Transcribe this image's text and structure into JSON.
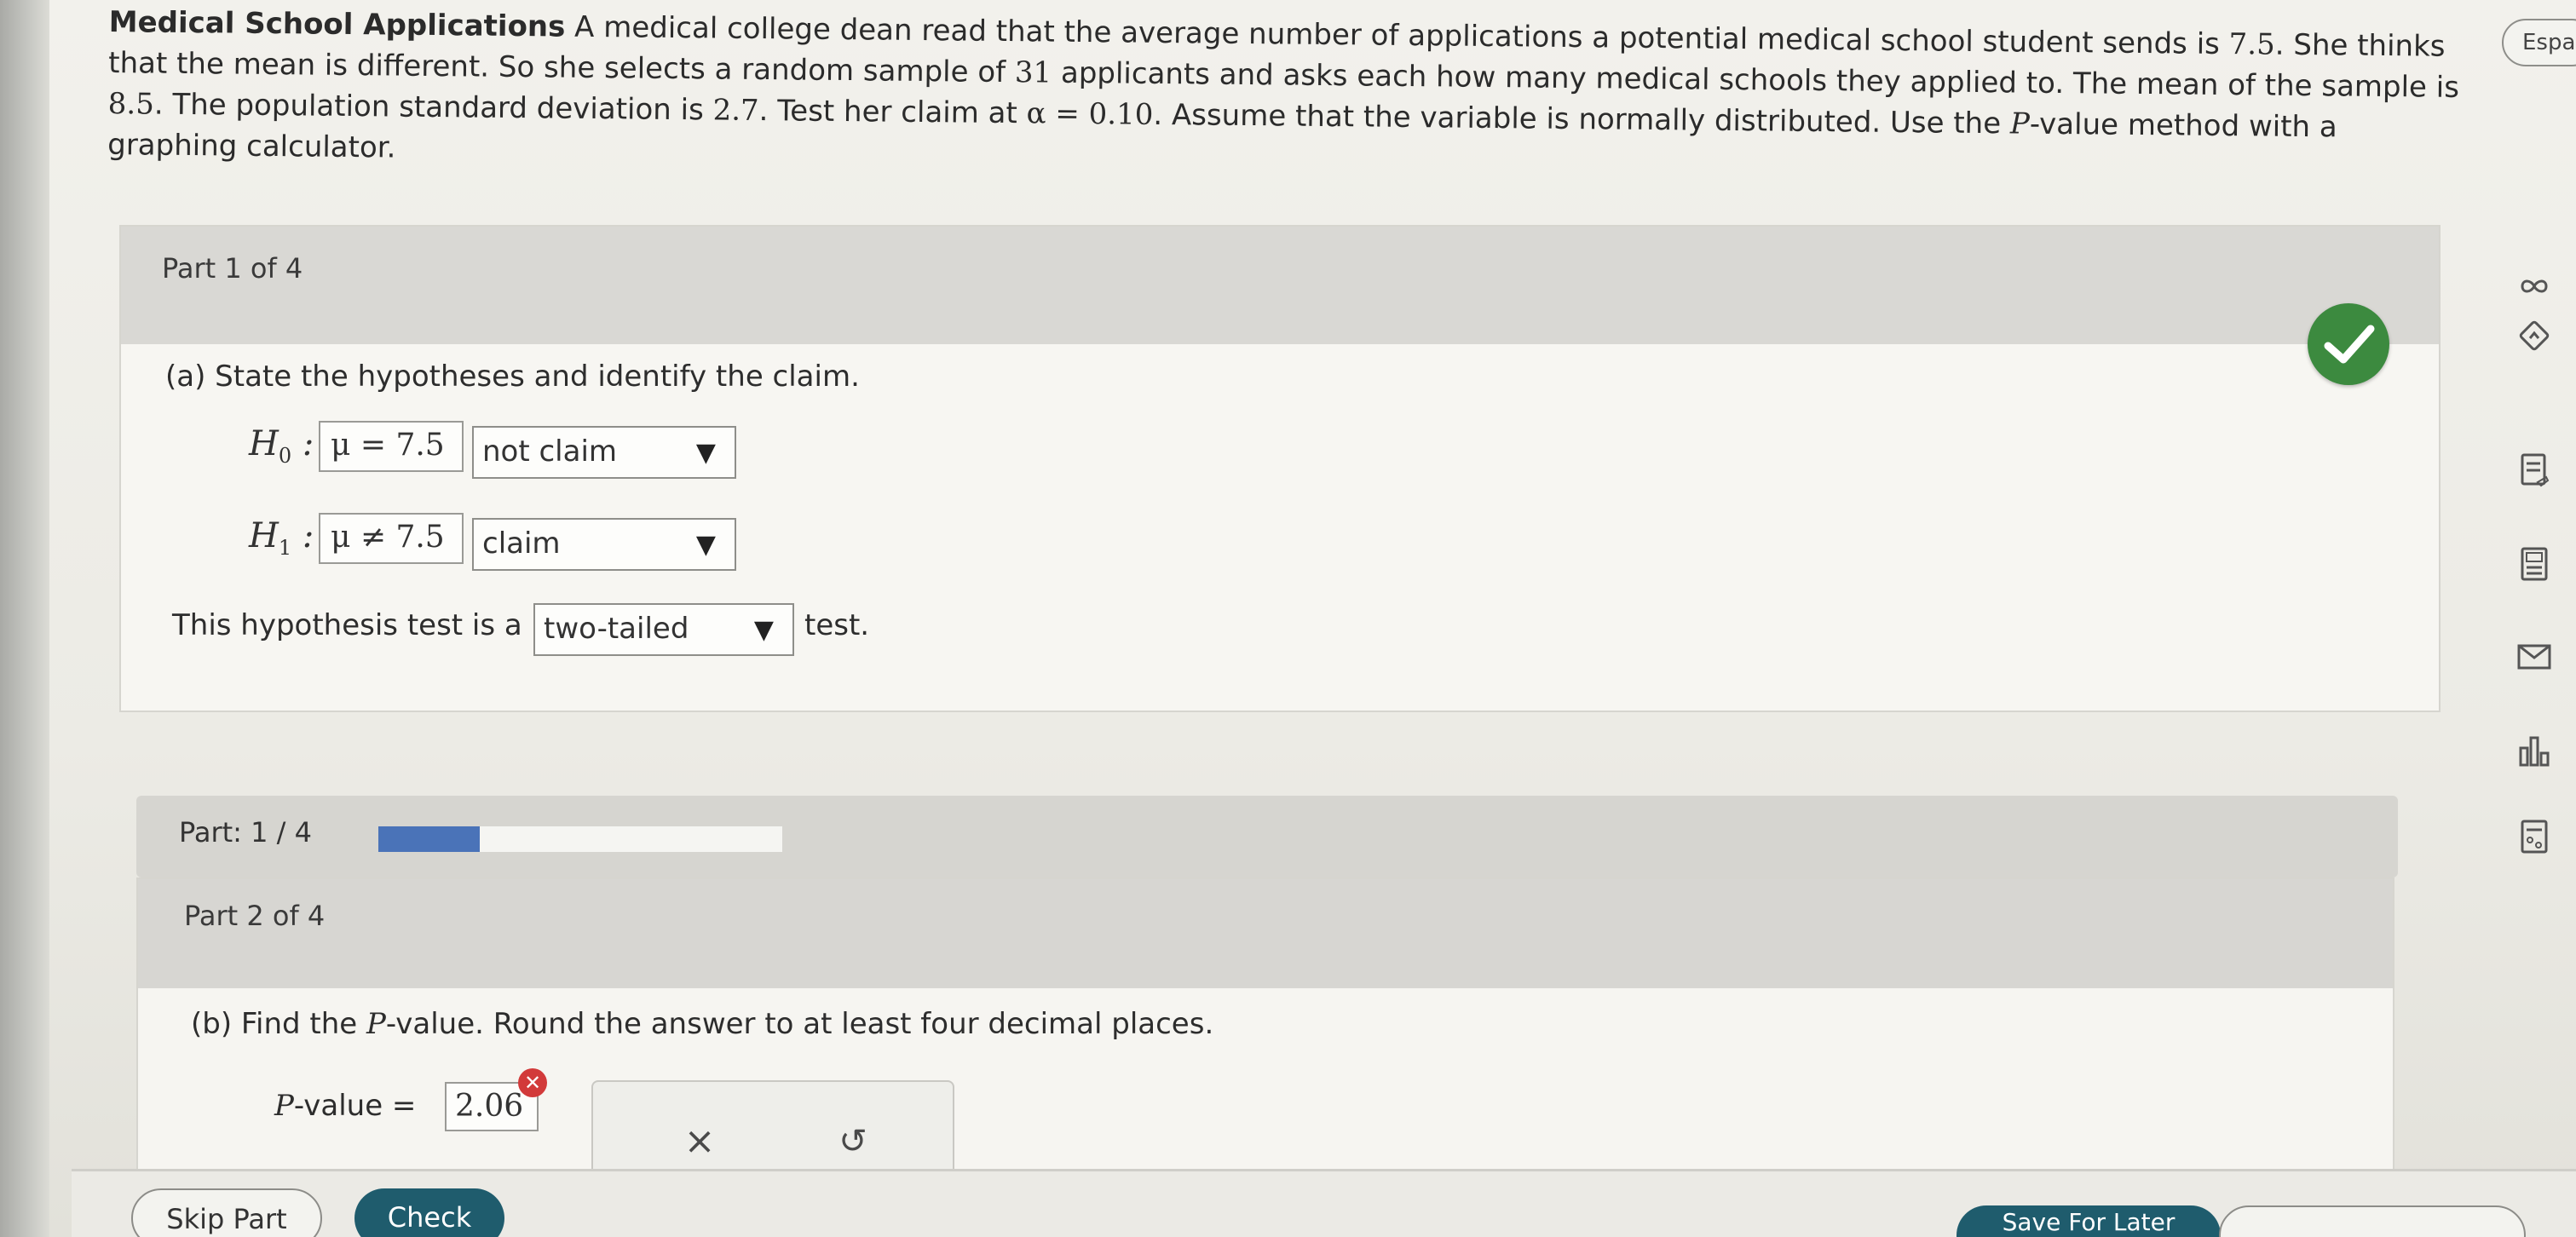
{
  "problem": {
    "title": "Medical School Applications",
    "text_1": " A medical college dean read that the average number of applications a potential medical school student sends is ",
    "mean_claimed": "7.5",
    "text_2": ". She thinks that the mean is different. So she selects a random sample of ",
    "sample_size": "31",
    "text_3": " applicants and asks each how many medical schools they applied to. The mean of the sample is ",
    "sample_mean": "8.5",
    "text_4": ". The population standard deviation is ",
    "sigma": "2.7",
    "text_5": ". Test her claim at ",
    "alpha": "α = 0.10",
    "text_6": ". Assume that the variable is normally distributed. Use the ",
    "p_letter": "P",
    "text_7": "-value method with a graphing calculator."
  },
  "part1": {
    "header": "Part 1 of 4",
    "question": "(a) State the hypotheses and identify the claim.",
    "h0_label": "H",
    "h0_sub": "0",
    "h0_value": "μ = 7.5",
    "h0_claim": "not claim",
    "h1_label": "H",
    "h1_sub": "1",
    "h1_value": "μ ≠ 7.5",
    "h1_claim": "claim",
    "test_prefix": "This hypothesis test is a",
    "test_type": "two-tailed",
    "test_suffix": "test."
  },
  "progress": {
    "label": "Part: 1 / 4",
    "fraction": 0.25,
    "color": "#4a73b8"
  },
  "part2": {
    "header": "Part 2 of 4",
    "question_prefix": "(b) Find the ",
    "question_p": "P",
    "question_suffix": "-value. Round the answer to at least four decimal places.",
    "pvalue_label_p": "P",
    "pvalue_label_rest": "-value =",
    "pvalue_input": "2.06"
  },
  "buttons": {
    "skip": "Skip Part",
    "check": "Check",
    "save": "Save For Later"
  },
  "rail": {
    "language": "Español"
  },
  "colors": {
    "accent": "#1f5c6d",
    "success": "#3c8a3f",
    "error": "#d23a3a"
  }
}
